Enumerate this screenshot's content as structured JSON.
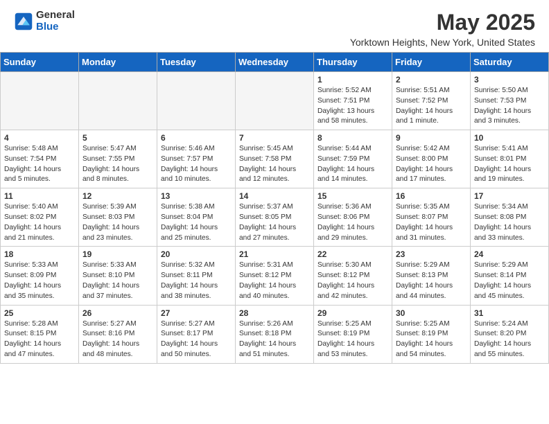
{
  "logo": {
    "general": "General",
    "blue": "Blue"
  },
  "title": "May 2025",
  "location": "Yorktown Heights, New York, United States",
  "days_of_week": [
    "Sunday",
    "Monday",
    "Tuesday",
    "Wednesday",
    "Thursday",
    "Friday",
    "Saturday"
  ],
  "weeks": [
    [
      {
        "day": "",
        "info": ""
      },
      {
        "day": "",
        "info": ""
      },
      {
        "day": "",
        "info": ""
      },
      {
        "day": "",
        "info": ""
      },
      {
        "day": "1",
        "info": "Sunrise: 5:52 AM\nSunset: 7:51 PM\nDaylight: 13 hours\nand 58 minutes."
      },
      {
        "day": "2",
        "info": "Sunrise: 5:51 AM\nSunset: 7:52 PM\nDaylight: 14 hours\nand 1 minute."
      },
      {
        "day": "3",
        "info": "Sunrise: 5:50 AM\nSunset: 7:53 PM\nDaylight: 14 hours\nand 3 minutes."
      }
    ],
    [
      {
        "day": "4",
        "info": "Sunrise: 5:48 AM\nSunset: 7:54 PM\nDaylight: 14 hours\nand 5 minutes."
      },
      {
        "day": "5",
        "info": "Sunrise: 5:47 AM\nSunset: 7:55 PM\nDaylight: 14 hours\nand 8 minutes."
      },
      {
        "day": "6",
        "info": "Sunrise: 5:46 AM\nSunset: 7:57 PM\nDaylight: 14 hours\nand 10 minutes."
      },
      {
        "day": "7",
        "info": "Sunrise: 5:45 AM\nSunset: 7:58 PM\nDaylight: 14 hours\nand 12 minutes."
      },
      {
        "day": "8",
        "info": "Sunrise: 5:44 AM\nSunset: 7:59 PM\nDaylight: 14 hours\nand 14 minutes."
      },
      {
        "day": "9",
        "info": "Sunrise: 5:42 AM\nSunset: 8:00 PM\nDaylight: 14 hours\nand 17 minutes."
      },
      {
        "day": "10",
        "info": "Sunrise: 5:41 AM\nSunset: 8:01 PM\nDaylight: 14 hours\nand 19 minutes."
      }
    ],
    [
      {
        "day": "11",
        "info": "Sunrise: 5:40 AM\nSunset: 8:02 PM\nDaylight: 14 hours\nand 21 minutes."
      },
      {
        "day": "12",
        "info": "Sunrise: 5:39 AM\nSunset: 8:03 PM\nDaylight: 14 hours\nand 23 minutes."
      },
      {
        "day": "13",
        "info": "Sunrise: 5:38 AM\nSunset: 8:04 PM\nDaylight: 14 hours\nand 25 minutes."
      },
      {
        "day": "14",
        "info": "Sunrise: 5:37 AM\nSunset: 8:05 PM\nDaylight: 14 hours\nand 27 minutes."
      },
      {
        "day": "15",
        "info": "Sunrise: 5:36 AM\nSunset: 8:06 PM\nDaylight: 14 hours\nand 29 minutes."
      },
      {
        "day": "16",
        "info": "Sunrise: 5:35 AM\nSunset: 8:07 PM\nDaylight: 14 hours\nand 31 minutes."
      },
      {
        "day": "17",
        "info": "Sunrise: 5:34 AM\nSunset: 8:08 PM\nDaylight: 14 hours\nand 33 minutes."
      }
    ],
    [
      {
        "day": "18",
        "info": "Sunrise: 5:33 AM\nSunset: 8:09 PM\nDaylight: 14 hours\nand 35 minutes."
      },
      {
        "day": "19",
        "info": "Sunrise: 5:33 AM\nSunset: 8:10 PM\nDaylight: 14 hours\nand 37 minutes."
      },
      {
        "day": "20",
        "info": "Sunrise: 5:32 AM\nSunset: 8:11 PM\nDaylight: 14 hours\nand 38 minutes."
      },
      {
        "day": "21",
        "info": "Sunrise: 5:31 AM\nSunset: 8:12 PM\nDaylight: 14 hours\nand 40 minutes."
      },
      {
        "day": "22",
        "info": "Sunrise: 5:30 AM\nSunset: 8:12 PM\nDaylight: 14 hours\nand 42 minutes."
      },
      {
        "day": "23",
        "info": "Sunrise: 5:29 AM\nSunset: 8:13 PM\nDaylight: 14 hours\nand 44 minutes."
      },
      {
        "day": "24",
        "info": "Sunrise: 5:29 AM\nSunset: 8:14 PM\nDaylight: 14 hours\nand 45 minutes."
      }
    ],
    [
      {
        "day": "25",
        "info": "Sunrise: 5:28 AM\nSunset: 8:15 PM\nDaylight: 14 hours\nand 47 minutes."
      },
      {
        "day": "26",
        "info": "Sunrise: 5:27 AM\nSunset: 8:16 PM\nDaylight: 14 hours\nand 48 minutes."
      },
      {
        "day": "27",
        "info": "Sunrise: 5:27 AM\nSunset: 8:17 PM\nDaylight: 14 hours\nand 50 minutes."
      },
      {
        "day": "28",
        "info": "Sunrise: 5:26 AM\nSunset: 8:18 PM\nDaylight: 14 hours\nand 51 minutes."
      },
      {
        "day": "29",
        "info": "Sunrise: 5:25 AM\nSunset: 8:19 PM\nDaylight: 14 hours\nand 53 minutes."
      },
      {
        "day": "30",
        "info": "Sunrise: 5:25 AM\nSunset: 8:19 PM\nDaylight: 14 hours\nand 54 minutes."
      },
      {
        "day": "31",
        "info": "Sunrise: 5:24 AM\nSunset: 8:20 PM\nDaylight: 14 hours\nand 55 minutes."
      }
    ]
  ]
}
